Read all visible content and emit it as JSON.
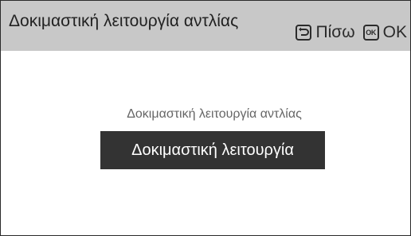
{
  "header": {
    "title": "Δοκιμαστική λειτουργία αντλίας",
    "back_icon": "back-arrow-icon",
    "back_label": "Πίσω",
    "ok_key_text": "OK",
    "ok_label": "OK"
  },
  "main": {
    "caption": "Δοκιμαστική λειτουργία αντλίας",
    "button_label": "Δοκιμαστική λειτουργία"
  },
  "colors": {
    "header_bg": "#c8c8c8",
    "button_bg": "#333333",
    "caption_text": "#666666"
  }
}
